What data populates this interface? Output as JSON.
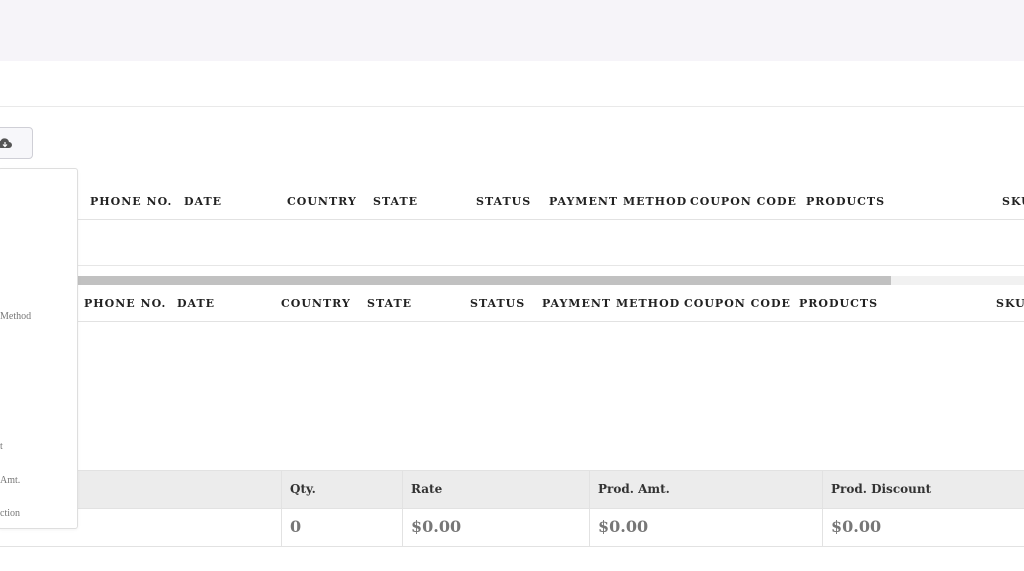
{
  "columns": [
    "PHONE NO.",
    "DATE",
    "COUNTRY",
    "STATE",
    "STATUS",
    "PAYMENT METHOD",
    "COUPON CODE",
    "PRODUCTS",
    "SKU"
  ],
  "column_menu": {
    "items": [
      "Method",
      "t",
      "Amt.",
      "ction"
    ]
  },
  "totals": {
    "headers": [
      "Qty.",
      "Rate",
      "Prod. Amt.",
      "Prod. Discount"
    ],
    "values": [
      "0",
      "$0.00",
      "$0.00",
      "$0.00"
    ]
  },
  "icons": {
    "export_button": "cloud-download-icon"
  },
  "colors": {
    "topbar": "#f6f4f9",
    "totals_header": "#ececec",
    "scroll_thumb": "#c1c1c1"
  }
}
